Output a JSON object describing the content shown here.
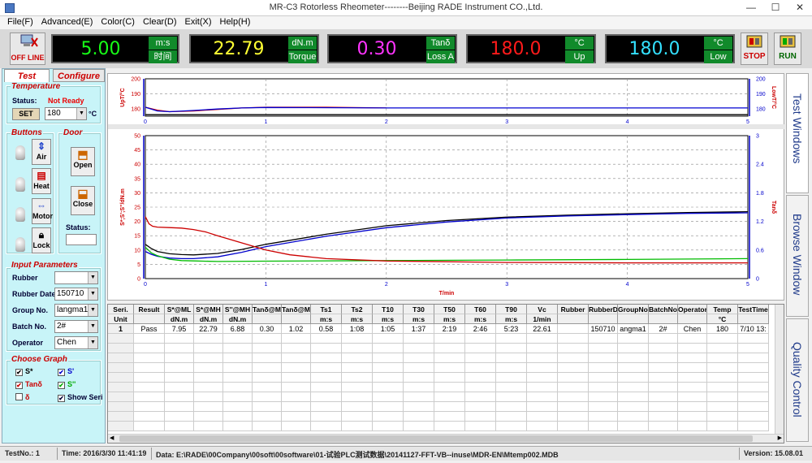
{
  "window": {
    "title": "MR-C3 Rotorless Rheometer--------Beijing RADE Instrument CO.,Ltd.",
    "min": "—",
    "max": "☐",
    "close": "✕"
  },
  "menu": [
    "File(F)",
    "Advanced(E)",
    "Color(C)",
    "Clear(D)",
    "Exit(X)",
    "Help(H)"
  ],
  "toolbar": {
    "offline_label": "OFF LINE",
    "stop_label": "STOP",
    "run_label": "RUN",
    "displays": [
      {
        "value": "5.00",
        "color": "#17ff17",
        "unit1": "m:s",
        "unit2": "时间"
      },
      {
        "value": "22.79",
        "color": "#ffff33",
        "unit1": "dN.m",
        "unit2": "Torque"
      },
      {
        "value": "0.30",
        "color": "#ff33ff",
        "unit1": "Tanδ",
        "unit2": "Loss A"
      },
      {
        "value": "180.0",
        "color": "#ff1a1a",
        "unit1": "°C",
        "unit2": "Up"
      },
      {
        "value": "180.0",
        "color": "#33e0ff",
        "unit1": "°C",
        "unit2": "Low"
      }
    ]
  },
  "left": {
    "tab_test": "Test",
    "tab_configure": "Configure",
    "temperature": {
      "title": "Temperature",
      "status_label": "Status:",
      "status_value": "Not Ready",
      "set_label": "SET",
      "set_value": "180",
      "unit": "°C"
    },
    "buttons_title": "Buttons",
    "door_title": "Door",
    "air": "Air",
    "heat": "Heat",
    "motor": "Motor",
    "lock": "Lock",
    "open": "Open",
    "close": "Close",
    "door_status_label": "Status:",
    "input_title": "Input Parameters",
    "inputs": [
      {
        "label": "Rubber",
        "value": ""
      },
      {
        "label": "Rubber Date",
        "value": "150710"
      },
      {
        "label": "Group No.",
        "value": "langma1"
      },
      {
        "label": "Batch No.",
        "value": "2#"
      },
      {
        "label": "Operator",
        "value": "Chen"
      }
    ],
    "graph_title": "Choose Graph",
    "graph": [
      {
        "label": "S*",
        "checked": true,
        "color": "#000"
      },
      {
        "label": "S'",
        "checked": true,
        "color": "#00c"
      },
      {
        "label": "Tanδ",
        "checked": true,
        "color": "#c00"
      },
      {
        "label": "S''",
        "checked": true,
        "color": "#0a0"
      },
      {
        "label": "δ",
        "checked": false,
        "color": "#c00"
      },
      {
        "label": "Show Seri",
        "checked": true,
        "color": "#003"
      }
    ]
  },
  "right_tabs": [
    "Test Windows",
    "Browse Window",
    "Quality Control"
  ],
  "chart_data": [
    {
      "type": "line",
      "x_ticks": [
        "0",
        "1",
        "2",
        "3",
        "4",
        "5"
      ],
      "y_left_ticks": [
        "180",
        "190",
        "200"
      ],
      "y_right_ticks": [
        "180",
        "190",
        "200"
      ],
      "ylabel_left": "UpT/°C",
      "ylabel_right": "LowT/°C",
      "xlim": [
        0,
        5
      ],
      "ylim": [
        175,
        200
      ],
      "series": [
        {
          "color": "#d00000",
          "x": [
            0,
            0.1,
            0.2,
            0.4,
            0.6,
            0.8,
            1.0,
            1.5,
            2.0
          ],
          "y": [
            181,
            179,
            178,
            178.5,
            179.5,
            180.5,
            181,
            181,
            180.5
          ]
        },
        {
          "color": "#0000d0",
          "x": [
            0,
            0.1,
            0.2,
            0.4,
            0.6,
            0.8,
            1.0,
            2,
            3,
            4,
            5
          ],
          "y": [
            181,
            178.5,
            178,
            178.8,
            179.8,
            180.5,
            180.8,
            180.5,
            180.5,
            180.5,
            180.5
          ]
        },
        {
          "color": "#000000",
          "x": [
            0,
            5
          ],
          "y": [
            176,
            176
          ]
        }
      ]
    },
    {
      "type": "line",
      "x_ticks": [
        "0",
        "1",
        "2",
        "3",
        "4",
        "5"
      ],
      "y_left_ticks": [
        "0",
        "5",
        "10",
        "15",
        "20",
        "25",
        "30",
        "35",
        "40",
        "45",
        "50"
      ],
      "y_right_ticks": [
        "0",
        "0.6",
        "1.2",
        "1.8",
        "2.4",
        "3"
      ],
      "xlabel": "T/min",
      "ylabel_left": "S*;S';S''/dN.m",
      "ylabel_right": "Tanδ",
      "xlim": [
        0,
        5
      ],
      "ylim": [
        0,
        50
      ],
      "y2lim": [
        0,
        3
      ],
      "series": [
        {
          "name": "S*",
          "color": "#000000",
          "x": [
            0,
            0.05,
            0.1,
            0.2,
            0.3,
            0.4,
            0.6,
            0.8,
            1,
            1.5,
            2,
            2.5,
            3,
            3.5,
            4,
            4.5,
            5
          ],
          "y": [
            12,
            10.5,
            9.5,
            8.7,
            8.4,
            8.3,
            8.8,
            10.2,
            12,
            15.5,
            18.5,
            20.3,
            21.5,
            22.2,
            22.7,
            23.1,
            23.4
          ]
        },
        {
          "name": "S'",
          "color": "#0000cc",
          "x": [
            0,
            0.05,
            0.1,
            0.2,
            0.3,
            0.4,
            0.6,
            0.8,
            1,
            1.5,
            2,
            2.5,
            3,
            3.5,
            4,
            4.5,
            5
          ],
          "y": [
            9.5,
            8.5,
            7.8,
            7.2,
            7.0,
            7.0,
            7.6,
            9.2,
            11.2,
            14.8,
            17.8,
            19.8,
            21.2,
            21.9,
            22.4,
            22.8,
            23.0
          ]
        },
        {
          "name": "S''",
          "color": "#00bb00",
          "x": [
            0,
            0.05,
            0.1,
            0.2,
            0.3,
            0.4,
            0.6,
            1,
            2,
            3,
            4,
            5
          ],
          "y": [
            11,
            9,
            8,
            6.8,
            6.3,
            6.2,
            6.0,
            6.1,
            6.3,
            6.5,
            6.7,
            7.0
          ]
        },
        {
          "name": "Tanδ",
          "color": "#cc0000",
          "x": [
            0,
            0.03,
            0.06,
            0.1,
            0.2,
            0.3,
            0.4,
            0.5,
            0.6,
            0.8,
            1,
            1.2,
            1.5,
            2,
            3,
            4,
            5
          ],
          "y": [
            1.3,
            1.15,
            1.1,
            1.08,
            1.07,
            1.06,
            1.03,
            0.98,
            0.9,
            0.75,
            0.6,
            0.5,
            0.42,
            0.37,
            0.34,
            0.33,
            0.33
          ]
        }
      ]
    }
  ],
  "table": {
    "headers": [
      [
        "Seri.",
        "Unit"
      ],
      [
        "Result",
        ""
      ],
      [
        "S*@ML",
        "dN.m"
      ],
      [
        "S*@MH",
        "dN.m"
      ],
      [
        "S''@MH",
        "dN.m"
      ],
      [
        "Tanδ@MH",
        ""
      ],
      [
        "Tanδ@ML",
        ""
      ],
      [
        "Ts1",
        "m:s"
      ],
      [
        "Ts2",
        "m:s"
      ],
      [
        "T10",
        "m:s"
      ],
      [
        "T30",
        "m:s"
      ],
      [
        "T50",
        "m:s"
      ],
      [
        "T60",
        "m:s"
      ],
      [
        "T90",
        "m:s"
      ],
      [
        "Vc",
        "1/min"
      ],
      [
        "Rubber",
        ""
      ],
      [
        "RubberDate",
        ""
      ],
      [
        "GroupNo.",
        ""
      ],
      [
        "BatchNo.",
        ""
      ],
      [
        "Operator",
        ""
      ],
      [
        "Temp",
        "°C"
      ],
      [
        "TestTime",
        ""
      ]
    ],
    "rows": [
      [
        "1",
        "Pass",
        "7.95",
        "22.79",
        "6.88",
        "0.30",
        "1.02",
        "0.58",
        "1:08",
        "1:05",
        "1:37",
        "2:19",
        "2:46",
        "5:23",
        "22.61",
        "",
        "150710",
        "angma1",
        "2#",
        "Chen",
        "180",
        "7/10 13:"
      ]
    ]
  },
  "status": {
    "test_no": "TestNo.: 1",
    "time": "Time: 2016/3/30 11:41:19",
    "data": "Data: E:\\RADE\\00Company\\00soft\\00software\\01-试验PLC测试数据\\20141127-FFT-VB--inuse\\MDR-EN\\Mtemp002.MDB",
    "version": "Version: 15.08.01"
  }
}
